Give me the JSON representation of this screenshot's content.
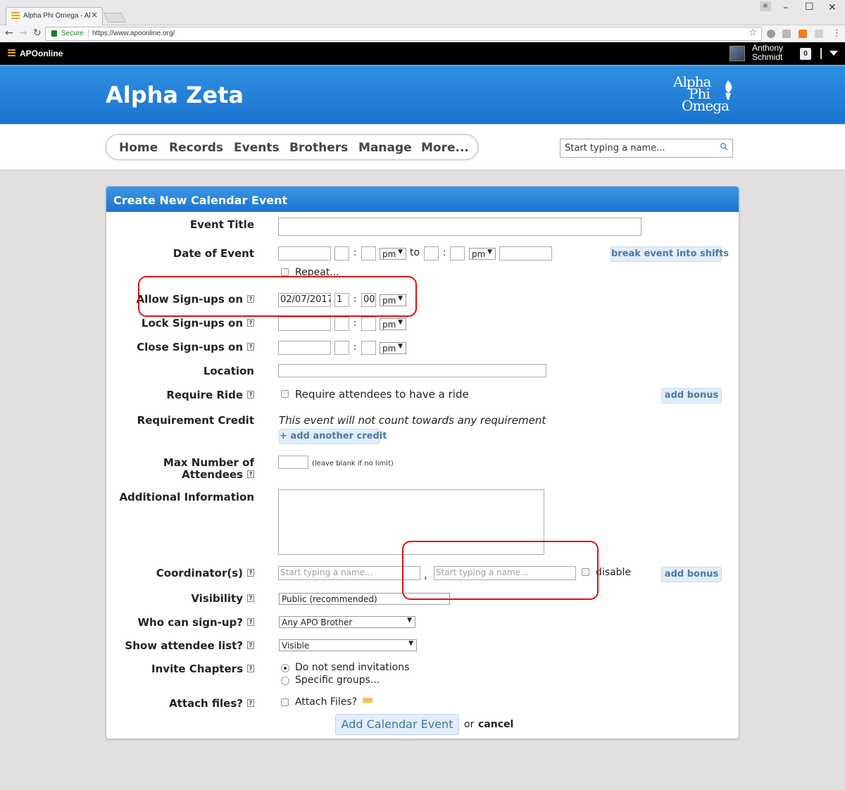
{
  "browser": {
    "tab_title": "Alpha Phi Omega - Alph",
    "secure_label": "Secure",
    "url": "https://www.apoonline.org/"
  },
  "site": {
    "brand": "APOonline",
    "user_first": "Anthony",
    "user_last": "Schmidt",
    "notifications": "0",
    "chapter": "Alpha Zeta",
    "logo_lines": [
      "Alpha",
      "Phi",
      "Omega"
    ]
  },
  "nav": {
    "items": [
      "Home",
      "Records",
      "Events",
      "Brothers",
      "Manage",
      "More..."
    ],
    "search_placeholder": "Start typing a name..."
  },
  "form": {
    "title": "Create New Calendar Event",
    "labels": {
      "event_title": "Event Title",
      "date_of_event": "Date of Event",
      "allow_signups": "Allow Sign-ups on",
      "lock_signups": "Lock Sign-ups on",
      "close_signups": "Close Sign-ups on",
      "location": "Location",
      "require_ride": "Require Ride",
      "requirement_credit": "Requirement Credit",
      "max_attendees_1": "Max Number of",
      "max_attendees_2": "Attendees",
      "additional_info": "Additional Information",
      "coordinators": "Coordinator(s)",
      "visibility": "Visibility",
      "who_can_signup": "Who can sign-up?",
      "show_attendee_list": "Show attendee list?",
      "invite_chapters": "Invite Chapters",
      "attach_files": "Attach files?"
    },
    "help_glyph": "?",
    "ampm_pm": "pm",
    "to_label": "to",
    "colon": ":",
    "repeat_label": "Repeat...",
    "break_shifts": "break event into shifts",
    "allow": {
      "date": "02/07/2017",
      "hour": "1",
      "minute": "00",
      "ampm": "pm"
    },
    "require_ride_text": "Require attendees to have a ride",
    "add_bonus": "add bonus",
    "requirement_text": "This event will not count towards any requirement",
    "add_credit": "+ add another credit",
    "max_hint": "(leave blank if no limit)",
    "coord_placeholder": "Start typing a name...",
    "comma": ",",
    "disable_label": "disable",
    "visibility_value": "Public (recommended)",
    "who_value": "Any APO Brother",
    "show_value": "Visible",
    "invite_options": [
      "Do not send invitations",
      "Specific groups..."
    ],
    "attach_text": "Attach Files?",
    "submit": "Add Calendar Event",
    "or_label": "or",
    "cancel": "cancel"
  },
  "colors": {
    "accent": "#1b74cf",
    "highlight": "#e01010",
    "button_bg": "#e2eef9"
  }
}
